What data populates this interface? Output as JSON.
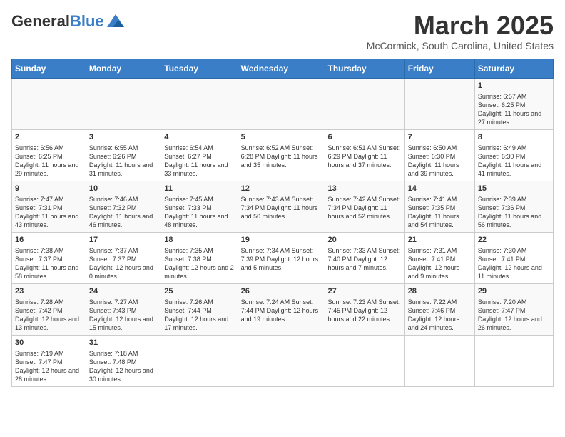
{
  "header": {
    "logo_general": "General",
    "logo_blue": "Blue",
    "title": "March 2025",
    "subtitle": "McCormick, South Carolina, United States"
  },
  "weekdays": [
    "Sunday",
    "Monday",
    "Tuesday",
    "Wednesday",
    "Thursday",
    "Friday",
    "Saturday"
  ],
  "weeks": [
    [
      {
        "day": "",
        "info": ""
      },
      {
        "day": "",
        "info": ""
      },
      {
        "day": "",
        "info": ""
      },
      {
        "day": "",
        "info": ""
      },
      {
        "day": "",
        "info": ""
      },
      {
        "day": "",
        "info": ""
      },
      {
        "day": "1",
        "info": "Sunrise: 6:57 AM\nSunset: 6:25 PM\nDaylight: 11 hours\nand 27 minutes."
      }
    ],
    [
      {
        "day": "2",
        "info": "Sunrise: 6:56 AM\nSunset: 6:25 PM\nDaylight: 11 hours\nand 29 minutes."
      },
      {
        "day": "3",
        "info": "Sunrise: 6:55 AM\nSunset: 6:26 PM\nDaylight: 11 hours\nand 31 minutes."
      },
      {
        "day": "4",
        "info": "Sunrise: 6:54 AM\nSunset: 6:27 PM\nDaylight: 11 hours\nand 33 minutes."
      },
      {
        "day": "5",
        "info": "Sunrise: 6:52 AM\nSunset: 6:28 PM\nDaylight: 11 hours\nand 35 minutes."
      },
      {
        "day": "6",
        "info": "Sunrise: 6:51 AM\nSunset: 6:29 PM\nDaylight: 11 hours\nand 37 minutes."
      },
      {
        "day": "7",
        "info": "Sunrise: 6:50 AM\nSunset: 6:30 PM\nDaylight: 11 hours\nand 39 minutes."
      },
      {
        "day": "8",
        "info": "Sunrise: 6:49 AM\nSunset: 6:30 PM\nDaylight: 11 hours\nand 41 minutes."
      }
    ],
    [
      {
        "day": "9",
        "info": "Sunrise: 7:47 AM\nSunset: 7:31 PM\nDaylight: 11 hours\nand 43 minutes."
      },
      {
        "day": "10",
        "info": "Sunrise: 7:46 AM\nSunset: 7:32 PM\nDaylight: 11 hours\nand 46 minutes."
      },
      {
        "day": "11",
        "info": "Sunrise: 7:45 AM\nSunset: 7:33 PM\nDaylight: 11 hours\nand 48 minutes."
      },
      {
        "day": "12",
        "info": "Sunrise: 7:43 AM\nSunset: 7:34 PM\nDaylight: 11 hours\nand 50 minutes."
      },
      {
        "day": "13",
        "info": "Sunrise: 7:42 AM\nSunset: 7:34 PM\nDaylight: 11 hours\nand 52 minutes."
      },
      {
        "day": "14",
        "info": "Sunrise: 7:41 AM\nSunset: 7:35 PM\nDaylight: 11 hours\nand 54 minutes."
      },
      {
        "day": "15",
        "info": "Sunrise: 7:39 AM\nSunset: 7:36 PM\nDaylight: 11 hours\nand 56 minutes."
      }
    ],
    [
      {
        "day": "16",
        "info": "Sunrise: 7:38 AM\nSunset: 7:37 PM\nDaylight: 11 hours\nand 58 minutes."
      },
      {
        "day": "17",
        "info": "Sunrise: 7:37 AM\nSunset: 7:37 PM\nDaylight: 12 hours\nand 0 minutes."
      },
      {
        "day": "18",
        "info": "Sunrise: 7:35 AM\nSunset: 7:38 PM\nDaylight: 12 hours\nand 2 minutes."
      },
      {
        "day": "19",
        "info": "Sunrise: 7:34 AM\nSunset: 7:39 PM\nDaylight: 12 hours\nand 5 minutes."
      },
      {
        "day": "20",
        "info": "Sunrise: 7:33 AM\nSunset: 7:40 PM\nDaylight: 12 hours\nand 7 minutes."
      },
      {
        "day": "21",
        "info": "Sunrise: 7:31 AM\nSunset: 7:41 PM\nDaylight: 12 hours\nand 9 minutes."
      },
      {
        "day": "22",
        "info": "Sunrise: 7:30 AM\nSunset: 7:41 PM\nDaylight: 12 hours\nand 11 minutes."
      }
    ],
    [
      {
        "day": "23",
        "info": "Sunrise: 7:28 AM\nSunset: 7:42 PM\nDaylight: 12 hours\nand 13 minutes."
      },
      {
        "day": "24",
        "info": "Sunrise: 7:27 AM\nSunset: 7:43 PM\nDaylight: 12 hours\nand 15 minutes."
      },
      {
        "day": "25",
        "info": "Sunrise: 7:26 AM\nSunset: 7:44 PM\nDaylight: 12 hours\nand 17 minutes."
      },
      {
        "day": "26",
        "info": "Sunrise: 7:24 AM\nSunset: 7:44 PM\nDaylight: 12 hours\nand 19 minutes."
      },
      {
        "day": "27",
        "info": "Sunrise: 7:23 AM\nSunset: 7:45 PM\nDaylight: 12 hours\nand 22 minutes."
      },
      {
        "day": "28",
        "info": "Sunrise: 7:22 AM\nSunset: 7:46 PM\nDaylight: 12 hours\nand 24 minutes."
      },
      {
        "day": "29",
        "info": "Sunrise: 7:20 AM\nSunset: 7:47 PM\nDaylight: 12 hours\nand 26 minutes."
      }
    ],
    [
      {
        "day": "30",
        "info": "Sunrise: 7:19 AM\nSunset: 7:47 PM\nDaylight: 12 hours\nand 28 minutes."
      },
      {
        "day": "31",
        "info": "Sunrise: 7:18 AM\nSunset: 7:48 PM\nDaylight: 12 hours\nand 30 minutes."
      },
      {
        "day": "",
        "info": ""
      },
      {
        "day": "",
        "info": ""
      },
      {
        "day": "",
        "info": ""
      },
      {
        "day": "",
        "info": ""
      },
      {
        "day": "",
        "info": ""
      }
    ]
  ]
}
